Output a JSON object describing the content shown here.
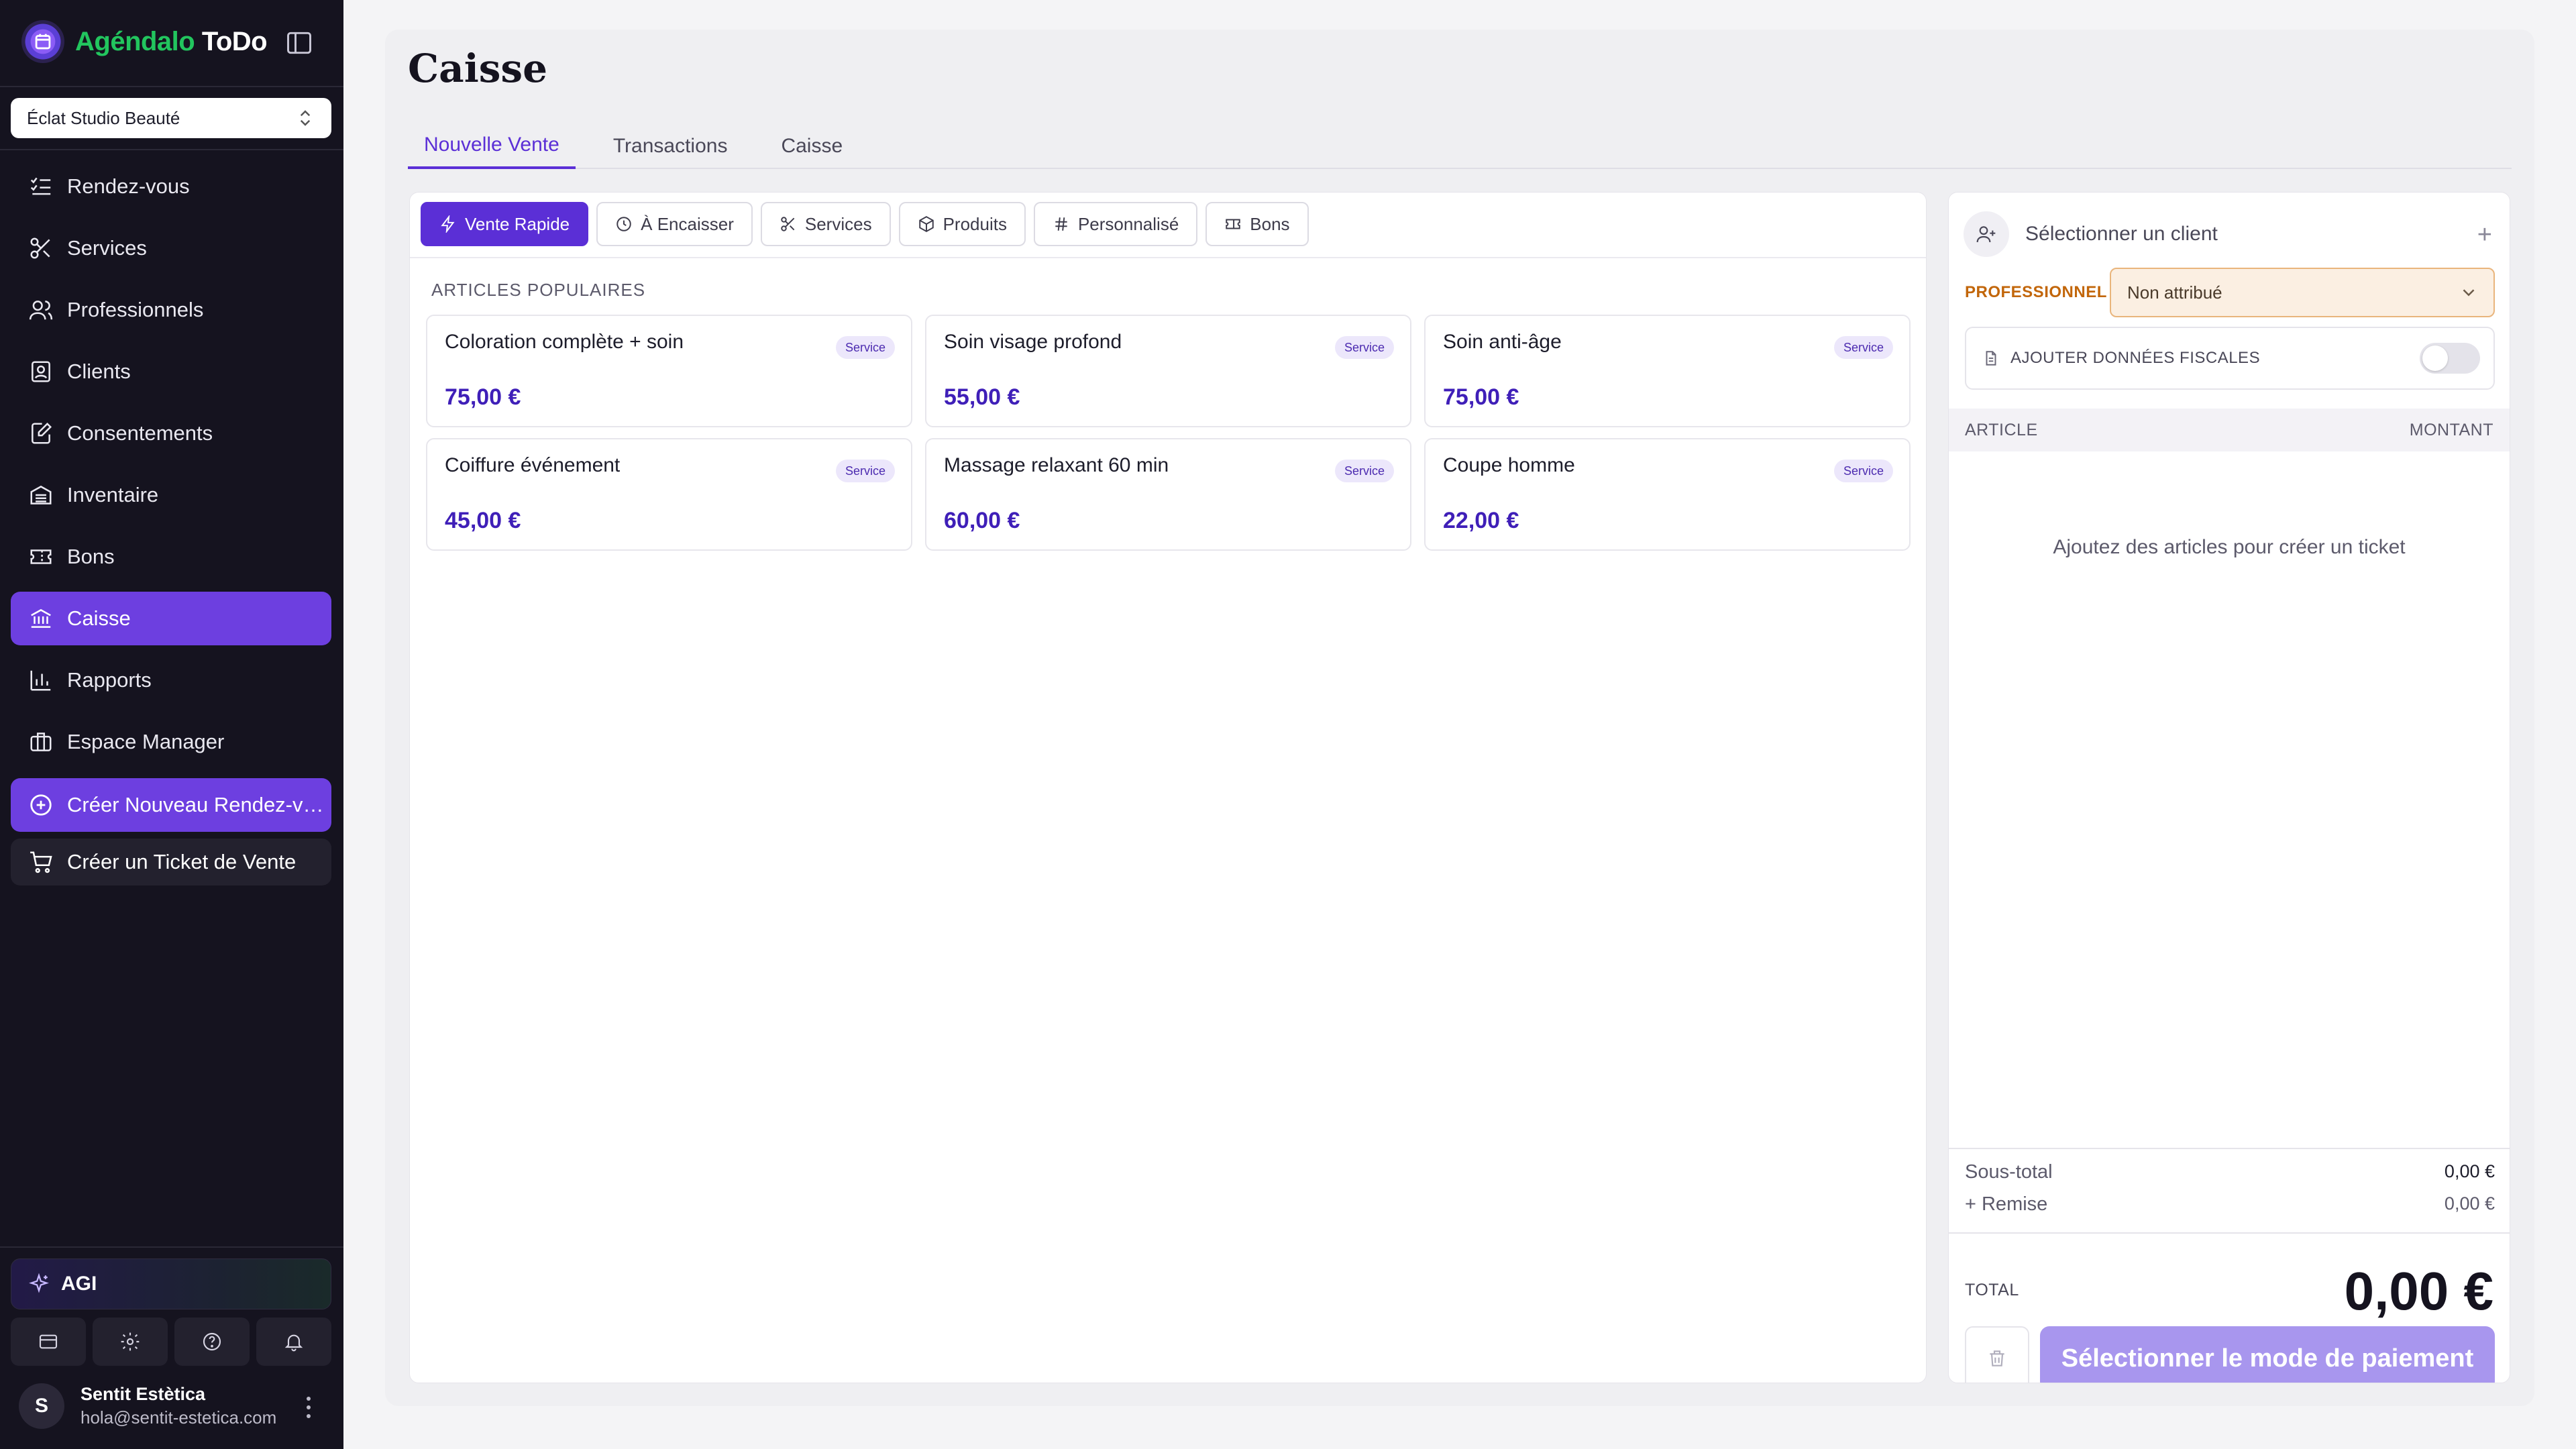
{
  "app": {
    "brand_accent": "Agéndalo",
    "brand_rest": " ToDo",
    "brand_color": "#22c55e",
    "accent_color": "#6d3fe0"
  },
  "sidebar": {
    "studio": "Éclat Studio Beauté",
    "items": [
      {
        "label": "Rendez-vous",
        "icon": "list-check-icon"
      },
      {
        "label": "Services",
        "icon": "scissors-icon"
      },
      {
        "label": "Professionnels",
        "icon": "users-icon"
      },
      {
        "label": "Clients",
        "icon": "contact-card-icon"
      },
      {
        "label": "Consentements",
        "icon": "document-edit-icon"
      },
      {
        "label": "Inventaire",
        "icon": "inventory-icon"
      },
      {
        "label": "Bons",
        "icon": "ticket-icon"
      },
      {
        "label": "Caisse",
        "icon": "bank-icon",
        "active": true
      },
      {
        "label": "Rapports",
        "icon": "bar-chart-icon"
      },
      {
        "label": "Espace Manager",
        "icon": "briefcase-icon"
      }
    ],
    "cta_new_appointment": "Créer Nouveau Rendez-vous",
    "cta_new_ticket": "Créer un Ticket de Vente",
    "agi_label": "AGI",
    "user": {
      "initial": "S",
      "name": "Sentit Estètica",
      "email": "hola@sentit-estetica.com"
    }
  },
  "page": {
    "title": "Caisse",
    "tabs": [
      "Nouvelle Vente",
      "Transactions",
      "Caisse"
    ],
    "active_tab": "Nouvelle Vente"
  },
  "categories": [
    "Vente Rapide",
    "À Encaisser",
    "Services",
    "Produits",
    "Personnalisé",
    "Bons"
  ],
  "popular": {
    "label": "ARTICLES POPULAIRES",
    "items": [
      {
        "name": "Coloration complète + soin",
        "badge": "Service",
        "price": "75,00 €"
      },
      {
        "name": "Soin visage profond",
        "badge": "Service",
        "price": "55,00 €"
      },
      {
        "name": "Soin anti-âge",
        "badge": "Service",
        "price": "75,00 €"
      },
      {
        "name": "Coiffure événement",
        "badge": "Service",
        "price": "45,00 €"
      },
      {
        "name": "Massage relaxant 60 min",
        "badge": "Service",
        "price": "60,00 €"
      },
      {
        "name": "Coupe homme",
        "badge": "Service",
        "price": "22,00 €"
      }
    ]
  },
  "ticket": {
    "client_placeholder": "Sélectionner un client",
    "add_symbol": "+",
    "pro_label": "PROFESSIONNEL",
    "pro_value": "Non attribué",
    "fiscal_label": "AJOUTER DONNÉES FISCALES",
    "col_article": "ARTICLE",
    "col_amount": "MONTANT",
    "empty": "Ajoutez des articles pour créer un ticket",
    "subtotal_label": "Sous-total",
    "subtotal_value": "0,00 €",
    "discount_label": "+ Remise",
    "discount_value": "0,00 €",
    "total_label": "TOTAL",
    "total_value": "0,00 €",
    "pay_button": "Sélectionner le mode de paiement"
  }
}
